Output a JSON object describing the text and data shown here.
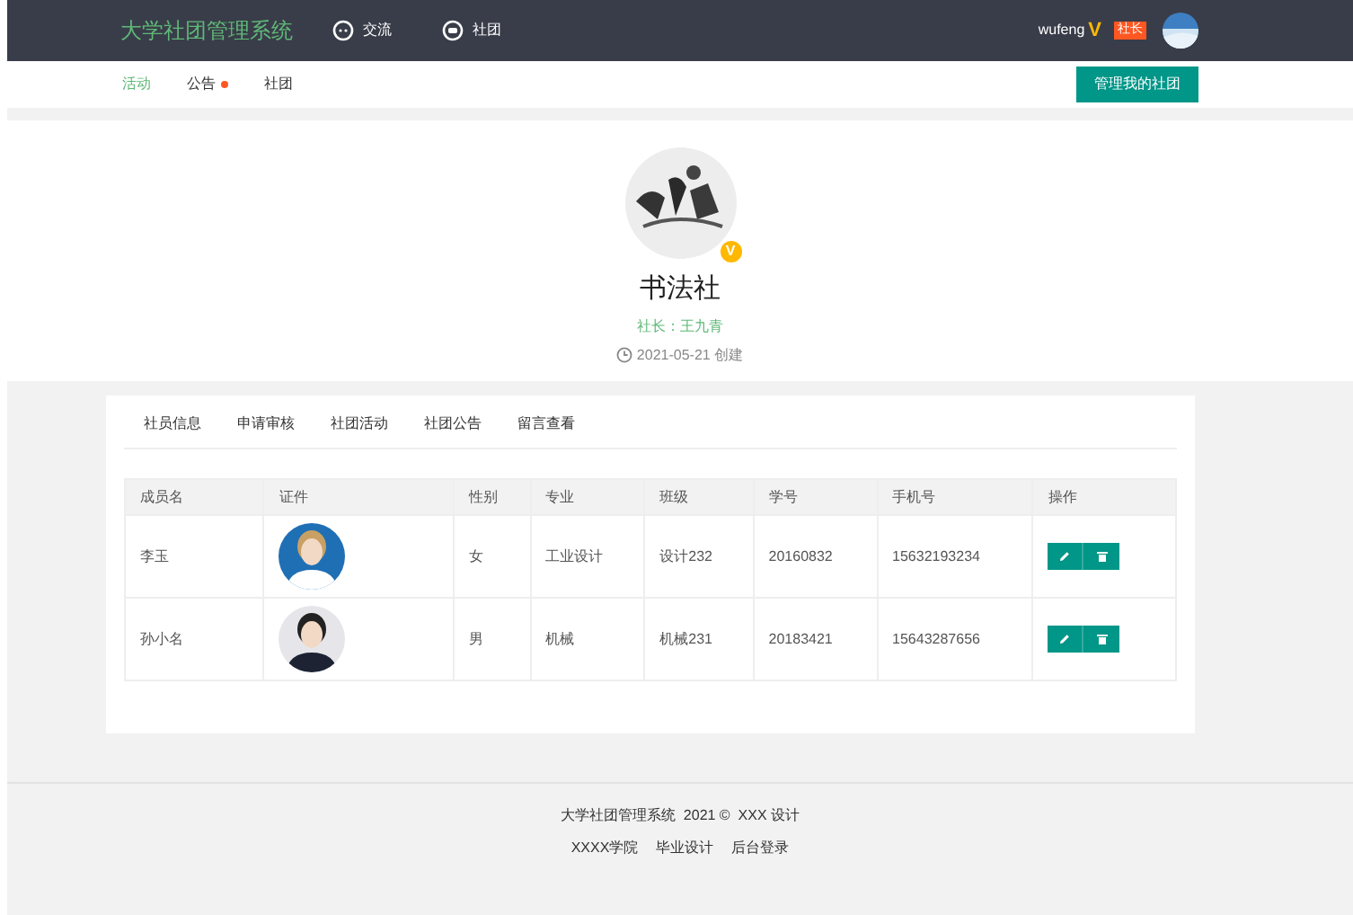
{
  "header": {
    "title": "大学社团管理系统",
    "nav": [
      {
        "kind": "chat",
        "label": "交流"
      },
      {
        "kind": "group",
        "label": "社团"
      }
    ],
    "user": {
      "name": "wufeng",
      "vip": "V",
      "role": "社长"
    }
  },
  "subnav": {
    "items": [
      {
        "label": "活动",
        "selected": true,
        "dot": false
      },
      {
        "label": "公告",
        "selected": false,
        "dot": true
      },
      {
        "label": "社团",
        "selected": false,
        "dot": false
      }
    ],
    "manage_button": "管理我的社团"
  },
  "club": {
    "badge": "V",
    "name": "书法社",
    "leader_label": "社长：",
    "leader": "王九青",
    "created": "2021-05-21 创建"
  },
  "tabs": [
    {
      "label": "社员信息",
      "selected": false
    },
    {
      "label": "申请审核",
      "selected": false
    },
    {
      "label": "社团活动",
      "selected": false
    },
    {
      "label": "社团公告",
      "selected": false
    },
    {
      "label": "留言查看",
      "selected": false
    }
  ],
  "table": {
    "columns": [
      "成员名",
      "证件",
      "性别",
      "专业",
      "班级",
      "学号",
      "手机号",
      "操作"
    ],
    "rows": [
      {
        "name": "李玉",
        "gender": "女",
        "major": "工业设计",
        "class": "设计232",
        "student_id": "20160832",
        "phone": "15632193234"
      },
      {
        "name": "孙小名",
        "gender": "男",
        "major": "机械",
        "class": "机械231",
        "student_id": "20183421",
        "phone": "15643287656"
      }
    ]
  },
  "footer": {
    "line": "大学社团管理系统  2021 ©  XXX 设计",
    "links": [
      "XXXX学院",
      "毕业设计",
      "后台登录"
    ]
  }
}
